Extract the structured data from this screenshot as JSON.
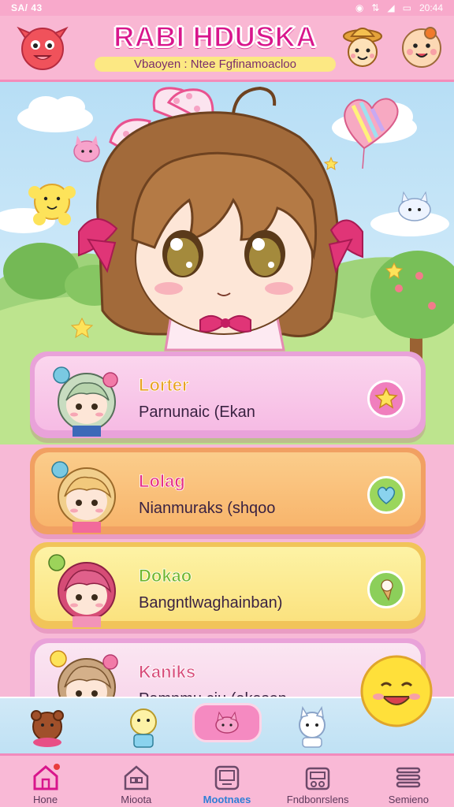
{
  "status_bar": {
    "left_text": "SA/ 43",
    "right_text": "20:44"
  },
  "header": {
    "title": "RABI HDUSKA",
    "subtitle": "Vbaoyen : Ntee Fgfinamoacloo"
  },
  "cards": [
    {
      "title": "Lorter",
      "subtitle": "Parnunaic (Ekan",
      "action_icon": "star-icon"
    },
    {
      "title": "Lolag",
      "subtitle": "Nianmuraks (shqoo",
      "action_icon": "heart-icon"
    },
    {
      "title": "Dokao",
      "subtitle": "Bangntlwaghainban)",
      "action_icon": "ice-cream-icon"
    },
    {
      "title": "Kaniks",
      "subtitle": "Pamnmu ciu (akason",
      "action_icon": "none"
    }
  ],
  "tabs": [
    {
      "label": "Hone",
      "icon": "home-icon",
      "active": false
    },
    {
      "label": "Mioota",
      "icon": "house-icon",
      "active": false
    },
    {
      "label": "Mootnaes",
      "icon": "tablet-icon",
      "active": true
    },
    {
      "label": "Fndbonrslens",
      "icon": "radio-icon",
      "active": false
    },
    {
      "label": "Semieno",
      "icon": "menu-icon",
      "active": false
    }
  ],
  "colors": {
    "brand_pink": "#f9b7d3",
    "title_magenta": "#d8168c",
    "active_tab_blue": "#2f7fd6"
  }
}
